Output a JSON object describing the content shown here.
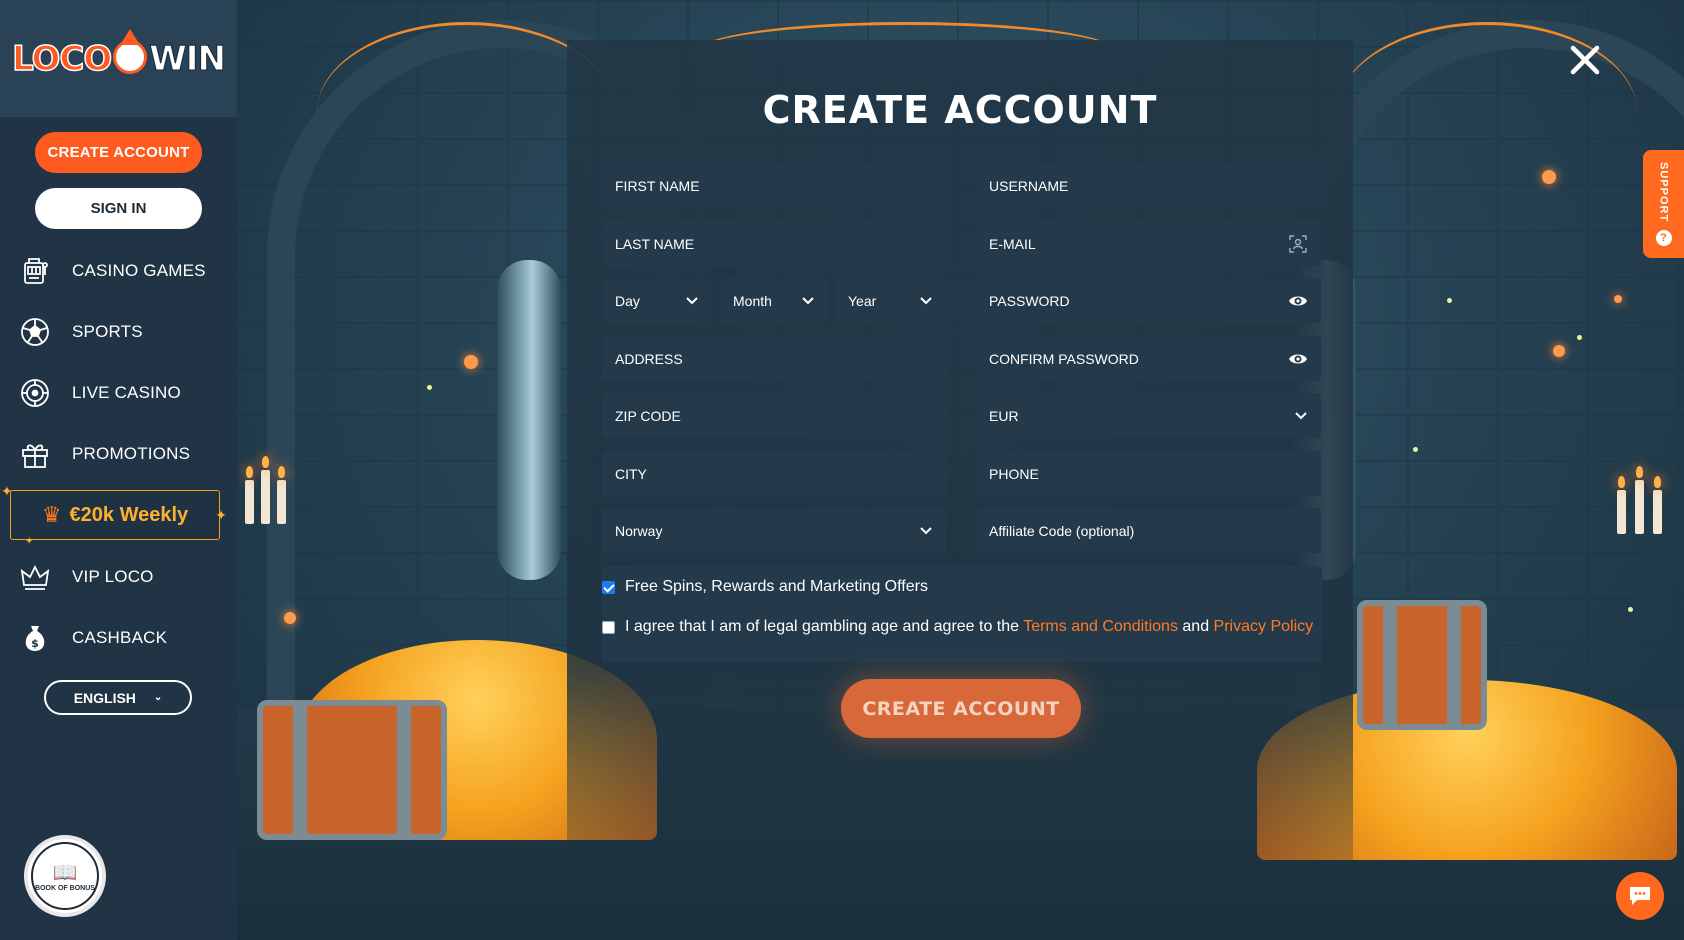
{
  "brand": {
    "logo_left": "LOCO",
    "logo_right": "WIN"
  },
  "sidebar": {
    "create_account": "CREATE ACCOUNT",
    "sign_in": "SIGN IN",
    "items": [
      {
        "label": "CASINO GAMES",
        "icon": "slot-machine-icon"
      },
      {
        "label": "SPORTS",
        "icon": "soccer-ball-icon"
      },
      {
        "label": "LIVE CASINO",
        "icon": "roulette-icon"
      },
      {
        "label": "PROMOTIONS",
        "icon": "gift-icon"
      }
    ],
    "weekly_promo": "€20k Weekly",
    "items2": [
      {
        "label": "VIP LOCO",
        "icon": "vip-crown-icon"
      },
      {
        "label": "CASHBACK",
        "icon": "money-bag-icon"
      }
    ],
    "language": "ENGLISH",
    "badge_text": "BOOK OF BONUS"
  },
  "modal": {
    "title": "CREATE ACCOUNT",
    "fields": {
      "first_name": "FIRST NAME",
      "username": "USERNAME",
      "last_name": "LAST NAME",
      "email": "E-MAIL",
      "day": "Day",
      "month": "Month",
      "year": "Year",
      "password": "PASSWORD",
      "address": "ADDRESS",
      "confirm_password": "CONFIRM PASSWORD",
      "zip_code": "ZIP CODE",
      "currency": "EUR",
      "city": "CITY",
      "phone": "PHONE",
      "country": "Norway",
      "affiliate": "Affiliate Code (optional)"
    },
    "consent_marketing": "Free Spins, Rewards and Marketing Offers",
    "consent_marketing_checked": true,
    "consent_terms_prefix": "I agree that I am of legal gambling age and agree to the ",
    "consent_terms_link": "Terms and Conditions",
    "consent_terms_and": " and ",
    "consent_privacy_link": "Privacy Policy",
    "consent_terms_checked": false,
    "submit": "CREATE ACCOUNT"
  },
  "support_tab": "SUPPORT",
  "colors": {
    "accent": "#ff5a1f",
    "sidebar": "#213445",
    "field": "#243a4b",
    "link": "#ff7a28",
    "promo": "#ffb02e"
  }
}
